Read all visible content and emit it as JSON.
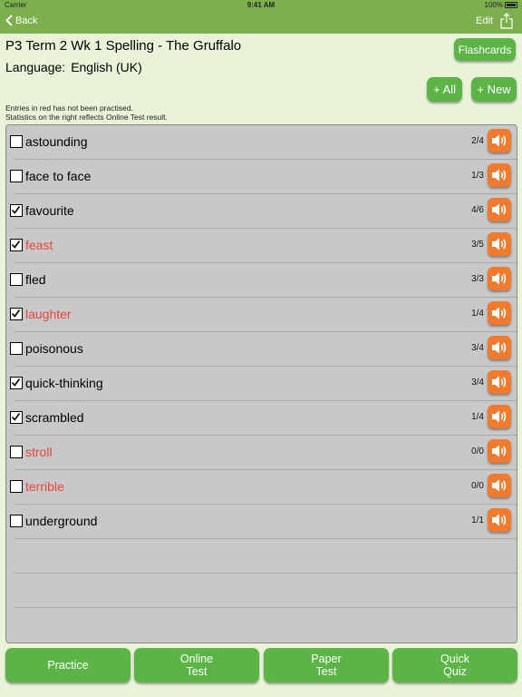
{
  "status": {
    "carrier": "Carrier",
    "time": "9:41 AM",
    "battery": "100%"
  },
  "nav": {
    "back": "Back",
    "edit": "Edit",
    "share_icon": "share-icon"
  },
  "header": {
    "title": "P3 Term 2 Wk 1 Spelling - The Gruffalo",
    "language_label": "Language:",
    "language_value": "English (UK)",
    "flashcards": "Flashcards",
    "add_all": "+ All",
    "add_new": "+ New"
  },
  "info": {
    "line1": "Entries in red has not been practised.",
    "line2": "Statistics on the right reflects Online Test result."
  },
  "words": [
    {
      "word": "astounding",
      "score": "2/4",
      "checked": false,
      "unpractised": false
    },
    {
      "word": "face to face",
      "score": "1/3",
      "checked": false,
      "unpractised": false
    },
    {
      "word": "favourite",
      "score": "4/6",
      "checked": true,
      "unpractised": false
    },
    {
      "word": "feast",
      "score": "3/5",
      "checked": true,
      "unpractised": true
    },
    {
      "word": "fled",
      "score": "3/3",
      "checked": false,
      "unpractised": false
    },
    {
      "word": "laughter",
      "score": "1/4",
      "checked": true,
      "unpractised": true
    },
    {
      "word": "poisonous",
      "score": "3/4",
      "checked": false,
      "unpractised": false
    },
    {
      "word": "quick-thinking",
      "score": "3/4",
      "checked": true,
      "unpractised": false
    },
    {
      "word": "scrambled",
      "score": "1/4",
      "checked": true,
      "unpractised": false
    },
    {
      "word": "stroll",
      "score": "0/0",
      "checked": false,
      "unpractised": true
    },
    {
      "word": "terrible",
      "score": "0/0",
      "checked": false,
      "unpractised": true
    },
    {
      "word": "underground",
      "score": "1/1",
      "checked": false,
      "unpractised": false
    }
  ],
  "bottom": {
    "practice": "Practice",
    "online_test": "Online\nTest",
    "paper_test": "Paper\nTest",
    "quick_quiz": "Quick\nQuiz"
  },
  "colors": {
    "green": "#7cb04d",
    "button_green": "#5cb446",
    "orange": "#f07a2e",
    "red_text": "#e8453c"
  }
}
